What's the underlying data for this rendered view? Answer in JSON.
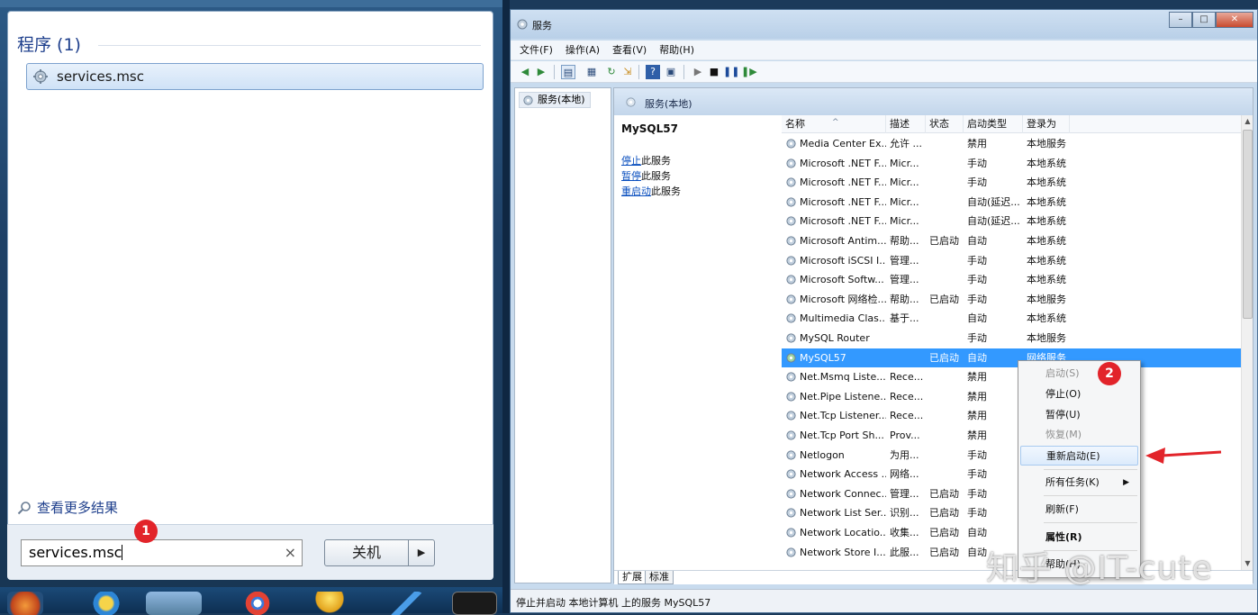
{
  "start_menu": {
    "programs_header": "程序 (1)",
    "result_label": "services.msc",
    "see_more": "查看更多结果",
    "search_value": "services.msc",
    "search_clear": "×",
    "shutdown_label": "关机",
    "shutdown_arrow": "▶",
    "badge": "1"
  },
  "services_window": {
    "title": "服务",
    "window_buttons": [
      "–",
      "□",
      "✕"
    ],
    "menu": [
      "文件(F)",
      "操作(A)",
      "查看(V)",
      "帮助(H)"
    ],
    "tree_node": "服务(本地)",
    "pane_header": "服务(本地)",
    "selected_service": "MySQL57",
    "desc_actions": [
      {
        "link": "停止",
        "rest": "此服务"
      },
      {
        "link": "暂停",
        "rest": "此服务"
      },
      {
        "link": "重启动",
        "rest": "此服务"
      }
    ],
    "columns": [
      "名称",
      "描述",
      "状态",
      "启动类型",
      "登录为"
    ],
    "rows": [
      {
        "name": "Media Center Ex...",
        "desc": "允许 ...",
        "status": "",
        "startup": "禁用",
        "logon": "本地服务"
      },
      {
        "name": "Microsoft .NET F...",
        "desc": "Micr...",
        "status": "",
        "startup": "手动",
        "logon": "本地系统"
      },
      {
        "name": "Microsoft .NET F...",
        "desc": "Micr...",
        "status": "",
        "startup": "手动",
        "logon": "本地系统"
      },
      {
        "name": "Microsoft .NET F...",
        "desc": "Micr...",
        "status": "",
        "startup": "自动(延迟...",
        "logon": "本地系统"
      },
      {
        "name": "Microsoft .NET F...",
        "desc": "Micr...",
        "status": "",
        "startup": "自动(延迟...",
        "logon": "本地系统"
      },
      {
        "name": "Microsoft Antim...",
        "desc": "帮助...",
        "status": "已启动",
        "startup": "自动",
        "logon": "本地系统"
      },
      {
        "name": "Microsoft iSCSI I...",
        "desc": "管理...",
        "status": "",
        "startup": "手动",
        "logon": "本地系统"
      },
      {
        "name": "Microsoft Softw...",
        "desc": "管理...",
        "status": "",
        "startup": "手动",
        "logon": "本地系统"
      },
      {
        "name": "Microsoft 网络检...",
        "desc": "帮助...",
        "status": "已启动",
        "startup": "手动",
        "logon": "本地服务"
      },
      {
        "name": "Multimedia Clas...",
        "desc": "基于...",
        "status": "",
        "startup": "自动",
        "logon": "本地系统"
      },
      {
        "name": "MySQL Router",
        "desc": "",
        "status": "",
        "startup": "手动",
        "logon": "本地服务"
      },
      {
        "name": "MySQL57",
        "desc": "",
        "status": "已启动",
        "startup": "自动",
        "logon": "网络服务"
      },
      {
        "name": "Net.Msmq Liste...",
        "desc": "Rece...",
        "status": "",
        "startup": "禁用",
        "logon": ""
      },
      {
        "name": "Net.Pipe Listene...",
        "desc": "Rece...",
        "status": "",
        "startup": "禁用",
        "logon": ""
      },
      {
        "name": "Net.Tcp Listener...",
        "desc": "Rece...",
        "status": "",
        "startup": "禁用",
        "logon": ""
      },
      {
        "name": "Net.Tcp Port Sh...",
        "desc": "Prov...",
        "status": "",
        "startup": "禁用",
        "logon": ""
      },
      {
        "name": "Netlogon",
        "desc": "为用...",
        "status": "",
        "startup": "手动",
        "logon": ""
      },
      {
        "name": "Network Access ...",
        "desc": "网络...",
        "status": "",
        "startup": "手动",
        "logon": ""
      },
      {
        "name": "Network Connec...",
        "desc": "管理...",
        "status": "已启动",
        "startup": "手动",
        "logon": ""
      },
      {
        "name": "Network List Ser...",
        "desc": "识别...",
        "status": "已启动",
        "startup": "手动",
        "logon": ""
      },
      {
        "name": "Network Locatio...",
        "desc": "收集...",
        "status": "已启动",
        "startup": "自动",
        "logon": ""
      },
      {
        "name": "Network Store I...",
        "desc": "此服...",
        "status": "已启动",
        "startup": "自动",
        "logon": ""
      }
    ],
    "tabs": [
      "扩展",
      "标准"
    ],
    "status_text": "停止并启动 本地计算机 上的服务 MySQL57"
  },
  "context_menu": {
    "badge": "2",
    "items": [
      {
        "label": "启动(S)",
        "disabled": true
      },
      {
        "label": "停止(O)",
        "disabled": false
      },
      {
        "label": "暂停(U)",
        "disabled": false
      },
      {
        "label": "恢复(M)",
        "disabled": true
      },
      {
        "label": "重新启动(E)",
        "disabled": false,
        "highlighted": true
      },
      {
        "label": "所有任务(K)",
        "disabled": false,
        "submenu": true
      },
      {
        "label": "刷新(F)",
        "disabled": false
      },
      {
        "label": "属性(R)",
        "disabled": false,
        "bold": true
      },
      {
        "label": "帮助(H)",
        "disabled": false
      }
    ],
    "submenu_arrow": "▶"
  },
  "watermark": "知乎 @IT-cute",
  "colors": {
    "selection": "#3399ff",
    "badge": "#e2242a",
    "link": "#0a4fbf",
    "arrow": "#e2242a"
  }
}
